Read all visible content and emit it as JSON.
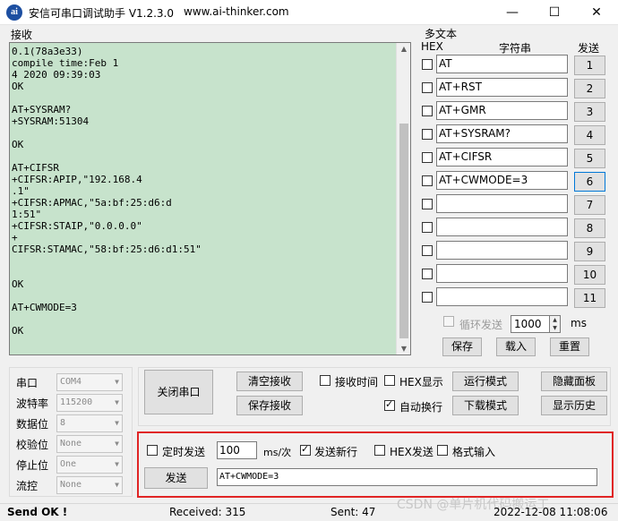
{
  "window": {
    "icon_text": "ai",
    "title": "安信可串口调试助手 V1.2.3.0",
    "url": "www.ai-thinker.com",
    "minimize": "—",
    "maximize": "☐",
    "close": "✕"
  },
  "receive": {
    "label": "接收",
    "text": "0.1(78a3e33)\ncompile time:Feb 1\n4 2020 09:39:03\nOK\n\nAT+SYSRAM?\n+SYSRAM:51304\n\nOK\n\nAT+CIFSR\n+CIFSR:APIP,\"192.168.4\n.1\"\n+CIFSR:APMAC,\"5a:bf:25:d6:d\n1:51\"\n+CIFSR:STAIP,\"0.0.0.0\"\n+\nCIFSR:STAMAC,\"58:bf:25:d6:d1:51\"\n\n\nOK\n\nAT+CWMODE=3\n\nOK",
    "scroll_up": "▲",
    "scroll_down": "▼"
  },
  "multi_text": {
    "title": "多文本",
    "hdr_hex": "HEX",
    "hdr_string": "字符串",
    "hdr_send": "发送",
    "rows": [
      {
        "value": "AT",
        "btn": "1"
      },
      {
        "value": "AT+RST",
        "btn": "2"
      },
      {
        "value": "AT+GMR",
        "btn": "3"
      },
      {
        "value": "AT+SYSRAM?",
        "btn": "4"
      },
      {
        "value": "AT+CIFSR",
        "btn": "5"
      },
      {
        "value": "AT+CWMODE=3",
        "btn": "6"
      },
      {
        "value": "",
        "btn": "7"
      },
      {
        "value": "",
        "btn": "8"
      },
      {
        "value": "",
        "btn": "9"
      },
      {
        "value": "",
        "btn": "10"
      },
      {
        "value": "",
        "btn": "11"
      }
    ],
    "loop_label": "循环发送",
    "loop_value": "1000",
    "loop_unit": "ms",
    "save": "保存",
    "load": "载入",
    "reset": "重置"
  },
  "serial": {
    "port_label": "串口",
    "port_value": "COM4",
    "baud_label": "波特率",
    "baud_value": "115200",
    "databits_label": "数据位",
    "databits_value": "8",
    "parity_label": "校验位",
    "parity_value": "None",
    "stopbits_label": "停止位",
    "stopbits_value": "One",
    "flow_label": "流控",
    "flow_value": "None"
  },
  "controls": {
    "close_port": "关闭串口",
    "clear_recv": "清空接收",
    "save_recv": "保存接收",
    "recv_time": "接收时间",
    "hex_display": "HEX显示",
    "auto_newline": "自动换行",
    "run_mode": "运行模式",
    "download_mode": "下载模式",
    "hide_panel": "隐藏面板",
    "show_history": "显示历史"
  },
  "send": {
    "timed_send": "定时发送",
    "interval": "100",
    "interval_unit": "ms/次",
    "send_newline": "发送新行",
    "hex_send": "HEX发送",
    "format_input": "格式输入",
    "send_button": "发送",
    "input_value": "AT+CWMODE=3"
  },
  "status": {
    "send_ok": "Send OK !",
    "received": "Received: 315",
    "sent": "Sent: 47",
    "datetime": "2022-12-08 11:08:06"
  },
  "watermark": "CSDN @单片机代码搬运工"
}
